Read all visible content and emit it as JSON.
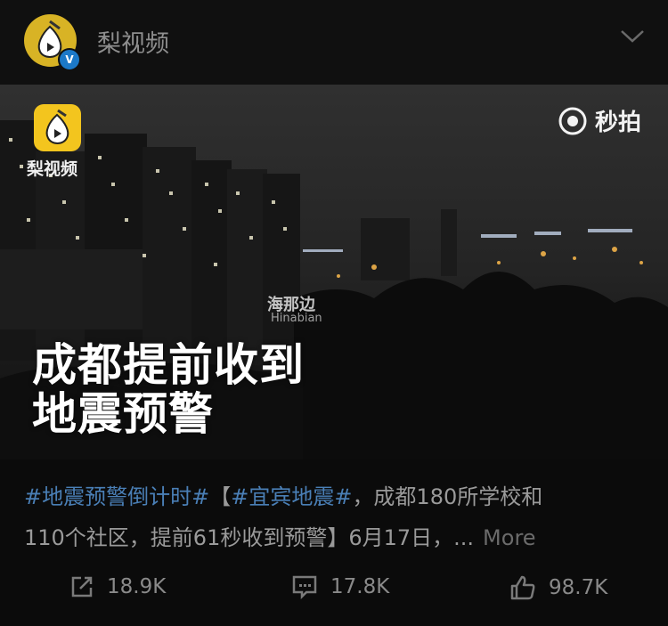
{
  "header": {
    "author": "梨视频",
    "verified_badge": "V"
  },
  "video": {
    "watermark_brand": "梨视频",
    "miaopai_label": "秒拍",
    "haina_watermark": "海那边",
    "haina_watermark_en": "Hinabian",
    "caption_line1": "成都提前收到",
    "caption_line2": "地震预警"
  },
  "post": {
    "tag1": "#地震预警倒计时#",
    "bracket_open": "【",
    "tag2": "#宜宾地震#",
    "body_line1_rest": "，成都180所学校和",
    "body_line2": "110个社区，提前61秒收到预警】6月17日，...",
    "more_label": "More"
  },
  "actions": {
    "repost_count": "18.9K",
    "comment_count": "17.8K",
    "like_count": "98.7K"
  },
  "icons": [
    "pear-logo-icon",
    "verified-icon",
    "chevron-down-icon",
    "miaopai-icon",
    "repost-icon",
    "comment-icon",
    "like-icon"
  ]
}
